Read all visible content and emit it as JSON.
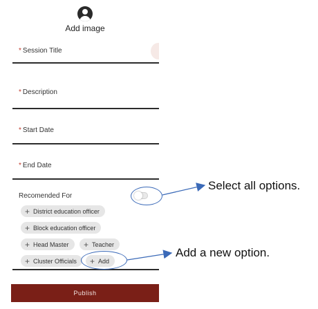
{
  "form": {
    "add_image": "Add image",
    "fields": [
      {
        "required": "*",
        "label": "Session Title"
      },
      {
        "required": "*",
        "label": "Description"
      },
      {
        "required": "*",
        "label": "Start Date"
      },
      {
        "required": "*",
        "label": "End Date"
      }
    ],
    "recommended_for": "Recomended For",
    "chips": [
      {
        "icon": "+",
        "label": "District education officer"
      },
      {
        "icon": "+",
        "label": "Block education officer"
      },
      {
        "icon": "+",
        "label": "Head Master"
      },
      {
        "icon": "+",
        "label": "Teacher"
      },
      {
        "icon": "+",
        "label": "Cluster Officials"
      },
      {
        "icon": "+",
        "label": "Add"
      }
    ],
    "publish": "Publish"
  },
  "annotations": {
    "select_all": "Select all options.",
    "add_new": "Add a new option."
  },
  "colors": {
    "publish_bar": "#7a1f17",
    "required_mark": "#c0392b",
    "annotation_arrow": "#3b6ab8"
  },
  "icons": {
    "avatar": "user-avatar-icon",
    "plus": "plus-icon"
  }
}
